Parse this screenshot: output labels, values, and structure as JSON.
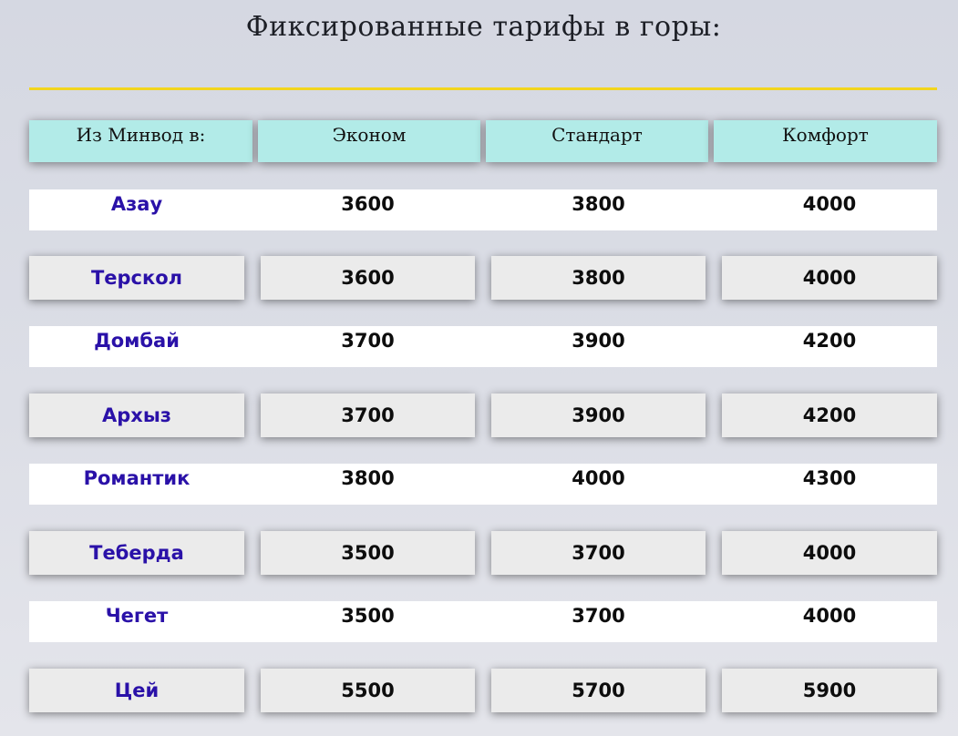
{
  "page": {
    "title": "Фиксированные тарифы в горы:",
    "accent_color": "#f2d51e"
  },
  "table": {
    "headers": [
      "Из Минвод в:",
      "Эконом",
      "Стандарт",
      "Комфорт"
    ],
    "rows": [
      {
        "city": "Азау",
        "econom": "3600",
        "standard": "3800",
        "comfort": "4000"
      },
      {
        "city": "Терскол",
        "econom": "3600",
        "standard": "3800",
        "comfort": "4000"
      },
      {
        "city": "Домбай",
        "econom": "3700",
        "standard": "3900",
        "comfort": "4200"
      },
      {
        "city": "Архыз",
        "econom": "3700",
        "standard": "3900",
        "comfort": "4200"
      },
      {
        "city": "Романтик",
        "econom": "3800",
        "standard": "4000",
        "comfort": "4300"
      },
      {
        "city": "Теберда",
        "econom": "3500",
        "standard": "3700",
        "comfort": "4000"
      },
      {
        "city": "Чегет",
        "econom": "3500",
        "standard": "3700",
        "comfort": "4000"
      },
      {
        "city": "Цей",
        "econom": "5500",
        "standard": "5700",
        "comfort": "5900"
      }
    ]
  }
}
